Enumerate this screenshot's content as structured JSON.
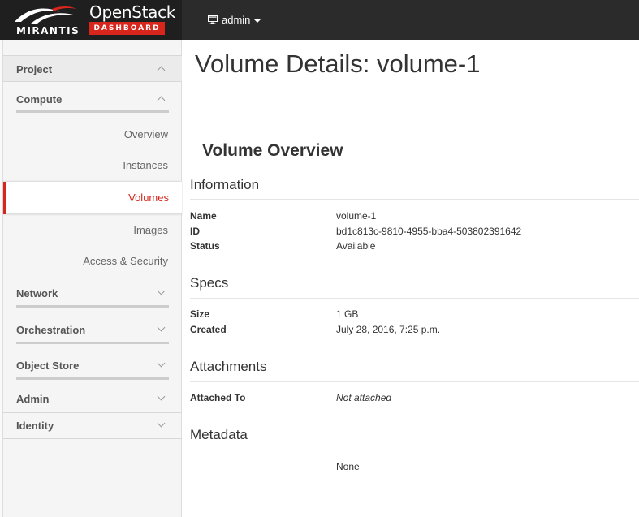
{
  "brand": {
    "company": "MIRANTIS",
    "product": "OpenStack",
    "badge": "DASHBOARD"
  },
  "header": {
    "user_icon": "desktop-icon",
    "user_label": "admin"
  },
  "sidebar": {
    "project": "Project",
    "compute": "Compute",
    "compute_items": [
      "Overview",
      "Instances",
      "Volumes",
      "Images",
      "Access & Security"
    ],
    "active_item": "Volumes",
    "network": "Network",
    "orchestration": "Orchestration",
    "object_store": "Object Store",
    "admin": "Admin",
    "identity": "Identity"
  },
  "page": {
    "title": "Volume Details: volume-1",
    "overview_title": "Volume Overview"
  },
  "sections": {
    "information": {
      "heading": "Information",
      "rows": [
        {
          "label": "Name",
          "value": "volume-1"
        },
        {
          "label": "ID",
          "value": "bd1c813c-9810-4955-bba4-503802391642"
        },
        {
          "label": "Status",
          "value": "Available"
        }
      ]
    },
    "specs": {
      "heading": "Specs",
      "rows": [
        {
          "label": "Size",
          "value": "1 GB"
        },
        {
          "label": "Created",
          "value": "July 28, 2016, 7:25 p.m."
        }
      ]
    },
    "attachments": {
      "heading": "Attachments",
      "rows": [
        {
          "label": "Attached To",
          "value": "Not attached"
        }
      ]
    },
    "metadata": {
      "heading": "Metadata",
      "value": "None"
    }
  },
  "colors": {
    "topbar": "#2b2b2b",
    "brand_bg": "#1f1f1f",
    "accent": "#d9261c"
  }
}
